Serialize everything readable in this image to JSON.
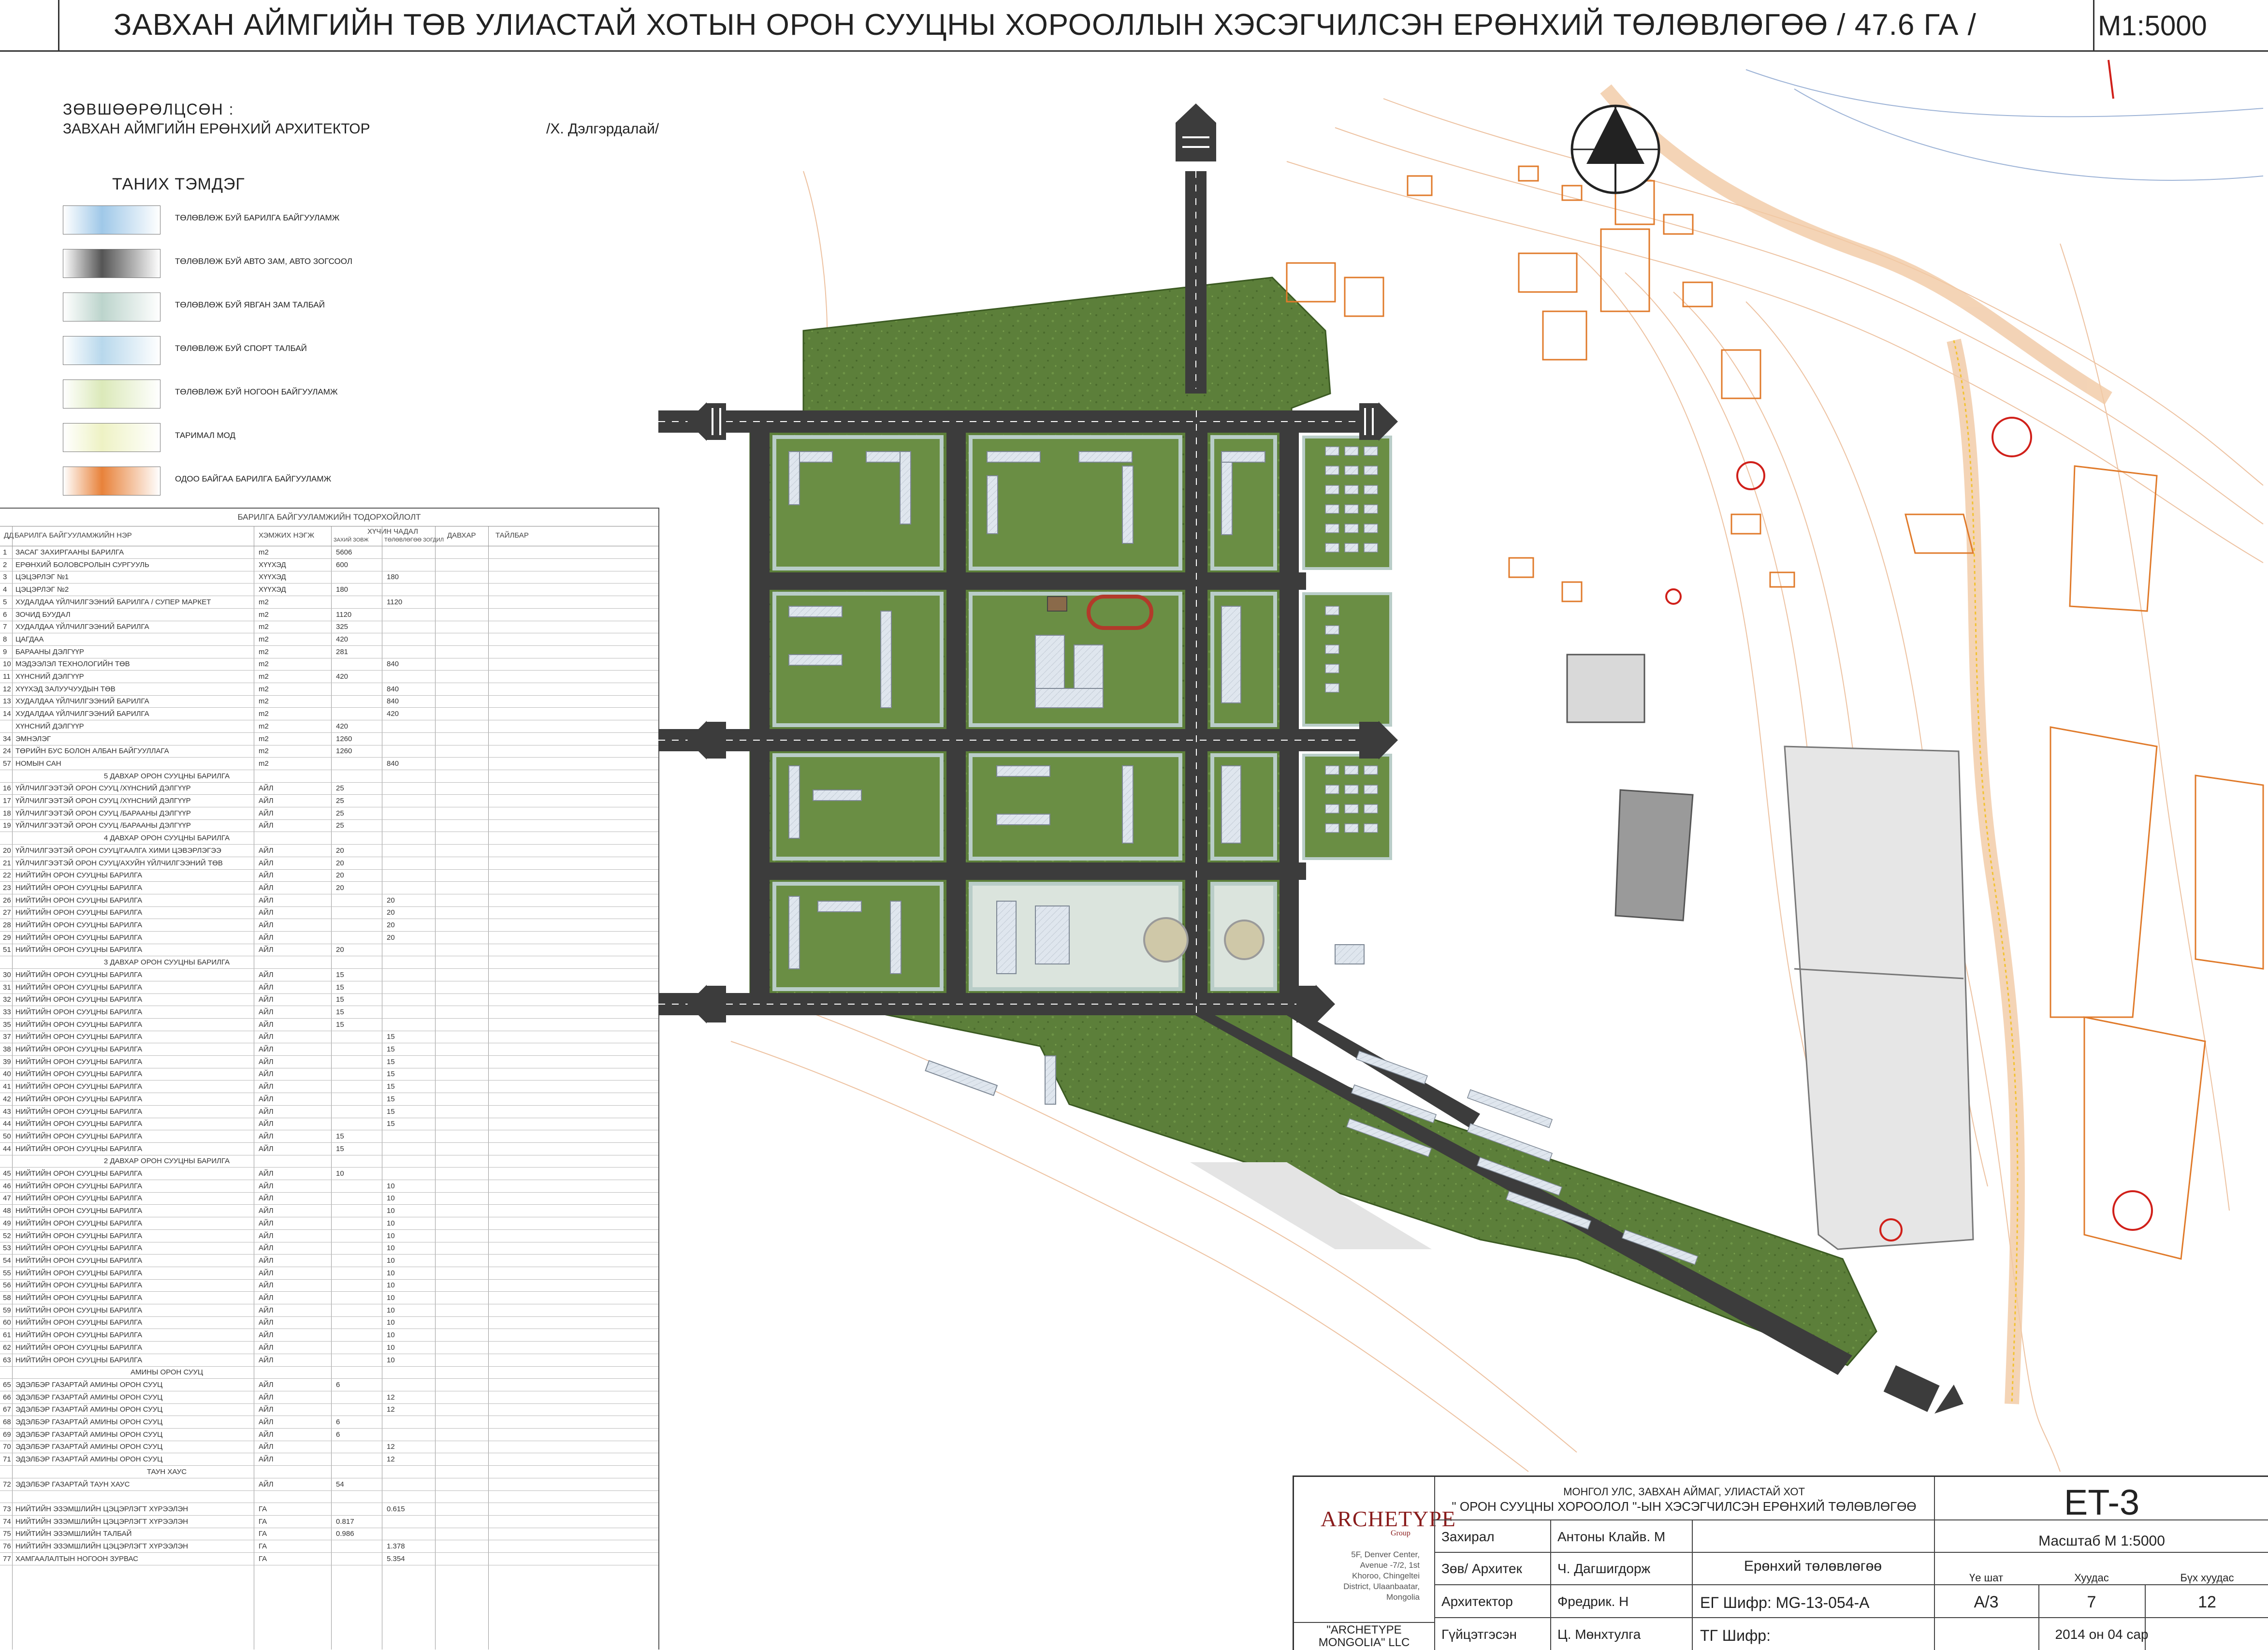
{
  "title_bar": {
    "title": "ЗАВХАН АЙМГИЙН ТӨВ УЛИАСТАЙ ХОТЫН ОРОН СУУЦНЫ ХОРООЛЛЫН ХЭСЭГЧИЛСЭН ЕРӨНХИЙ ТӨЛӨВЛӨГӨӨ / 47.6 ГА /",
    "scale": "М1:5000"
  },
  "approval": {
    "heading": "ЗӨВШӨӨРӨЛЦСӨН :",
    "position": "ЗАВХАН АЙМГИЙН ЕРӨНХИЙ АРХИТЕКТОР",
    "name": "/Х. Дэлгэрдалай/"
  },
  "legend": {
    "title": "ТАНИХ ТЭМДЭГ",
    "items": [
      {
        "label": "ТӨЛӨВЛӨЖ БУЙ БАРИЛГА БАЙГУУЛАМЖ",
        "icon": "building-swatch",
        "color": "#9fc8e8"
      },
      {
        "label": "ТӨЛӨВЛӨЖ БУЙ АВТО ЗАМ, АВТО ЗОГСООЛ",
        "icon": "road-swatch",
        "color": "#555555"
      },
      {
        "label": "ТӨЛӨВЛӨЖ БУЙ ЯВГАН ЗАМ ТАЛБАЙ",
        "icon": "sidewalk-swatch",
        "color": "#bcd4cc"
      },
      {
        "label": "ТӨЛӨВЛӨЖ БУЙ СПОРТ ТАЛБАЙ",
        "icon": "sport-swatch",
        "color": "#b8d8ec"
      },
      {
        "label": "ТӨЛӨВЛӨЖ БУЙ НОГООН БАЙГУУЛАМЖ",
        "icon": "green-swatch",
        "color": "#dbe9b9"
      },
      {
        "label": "ТАРИМАЛ МОД",
        "icon": "tree-swatch",
        "color": "#eef2c4"
      },
      {
        "label": "ОДОО БАЙГАА БАРИЛГА БАЙГУУЛАМЖ",
        "icon": "existing-building-swatch",
        "color": "#e8823a"
      }
    ]
  },
  "building_table": {
    "caption": "БАРИЛГА БАЙГУУЛАМЖИЙН ТОДОРХОЙЛОЛТ",
    "columns": [
      "ДД",
      "БАРИЛГА БАЙГУУЛАМЖИЙН НЭР",
      "ХЭМЖИХ НЭГЖ",
      "ХҮЧИН ЧАДАЛ",
      "ДАВХАР",
      "ТАЙЛБАР"
    ],
    "subcolumns": [
      "ЗАХИЙ ЗОВЖ",
      "ТӨЛӨВЛӨГӨӨ ЗОГДИЛ"
    ],
    "rows": [
      {
        "no": "1",
        "name": "ЗАСАГ ЗАХИРГААНЫ БАРИЛГА",
        "unit": "m2",
        "c1": "5606",
        "c2": ""
      },
      {
        "no": "2",
        "name": "ЕРӨНХИЙ БОЛОВСРОЛЫН СУРГУУЛЬ",
        "unit": "ХҮҮХЭД",
        "c1": "600",
        "c2": ""
      },
      {
        "no": "3",
        "name": "ЦЭЦЭРЛЭГ №1",
        "unit": "ХҮҮХЭД",
        "c1": "",
        "c2": "180"
      },
      {
        "no": "4",
        "name": "ЦЭЦЭРЛЭГ №2",
        "unit": "ХҮҮХЭД",
        "c1": "180",
        "c2": ""
      },
      {
        "no": "5",
        "name": "ХУДАЛДАА ҮЙЛЧИЛГЭЭНИЙ БАРИЛГА / СУПЕР МАРКЕТ",
        "unit": "m2",
        "c1": "",
        "c2": "1120"
      },
      {
        "no": "6",
        "name": "ЗОЧИД БУУДАЛ",
        "unit": "m2",
        "c1": "1120",
        "c2": ""
      },
      {
        "no": "7",
        "name": "ХУДАЛДАА ҮЙЛЧИЛГЭЭНИЙ БАРИЛГА",
        "unit": "m2",
        "c1": "325",
        "c2": ""
      },
      {
        "no": "8",
        "name": "ЦАГДАА",
        "unit": "m2",
        "c1": "420",
        "c2": ""
      },
      {
        "no": "9",
        "name": "БАРААНЫ ДЭЛГҮҮР",
        "unit": "m2",
        "c1": "281",
        "c2": ""
      },
      {
        "no": "10",
        "name": "МЭДЭЭЛЭЛ ТЕХНОЛОГИЙН ТӨВ",
        "unit": "m2",
        "c1": "",
        "c2": "840"
      },
      {
        "no": "11",
        "name": "ХҮНСНИЙ ДЭЛГҮҮР",
        "unit": "m2",
        "c1": "420",
        "c2": ""
      },
      {
        "no": "12",
        "name": "ХҮҮХЭД ЗАЛУУЧУУДЫН ТӨВ",
        "unit": "m2",
        "c1": "",
        "c2": "840"
      },
      {
        "no": "13",
        "name": "ХУДАЛДАА ҮЙЛЧИЛГЭЭНИЙ БАРИЛГА",
        "unit": "m2",
        "c1": "",
        "c2": "840"
      },
      {
        "no": "14",
        "name": "ХУДАЛДАА ҮЙЛЧИЛГЭЭНИЙ БАРИЛГА",
        "unit": "m2",
        "c1": "",
        "c2": "420"
      },
      {
        "no": "",
        "name": "ХҮНСНИЙ ДЭЛГҮҮР",
        "unit": "m2",
        "c1": "420",
        "c2": ""
      },
      {
        "no": "34",
        "name": "ЭМНЭЛЭГ",
        "unit": "m2",
        "c1": "1260",
        "c2": ""
      },
      {
        "no": "24",
        "name": "ТӨРИЙН БУС БОЛОН АЛБАН БАЙГУУЛЛАГА",
        "unit": "m2",
        "c1": "1260",
        "c2": ""
      },
      {
        "no": "57",
        "name": "НОМЫН САН",
        "unit": "m2",
        "c1": "",
        "c2": "840"
      },
      {
        "section": "5 ДАВХАР ОРОН СУУЦНЫ БАРИЛГА"
      },
      {
        "no": "16",
        "name": "ҮЙЛЧИЛГЭЭТЭЙ ОРОН СУУЦ /ХҮНСНИЙ ДЭЛГҮҮР",
        "unit": "АЙЛ",
        "c1": "25",
        "c2": ""
      },
      {
        "no": "17",
        "name": "ҮЙЛЧИЛГЭЭТЭЙ ОРОН СУУЦ /ХҮНСНИЙ ДЭЛГҮҮР",
        "unit": "АЙЛ",
        "c1": "25",
        "c2": ""
      },
      {
        "no": "18",
        "name": "ҮЙЛЧИЛГЭЭТЭЙ ОРОН СУУЦ /БАРААНЫ ДЭЛГҮҮР",
        "unit": "АЙЛ",
        "c1": "25",
        "c2": ""
      },
      {
        "no": "19",
        "name": "ҮЙЛЧИЛГЭЭТЭЙ ОРОН СУУЦ /БАРААНЫ ДЭЛГҮҮР",
        "unit": "АЙЛ",
        "c1": "25",
        "c2": ""
      },
      {
        "section": "4 ДАВХАР ОРОН СУУЦНЫ БАРИЛГА"
      },
      {
        "no": "20",
        "name": "ҮЙЛЧИЛГЭЭТЭЙ ОРОН СУУЦ/ГААЛГА ХИМИ ЦЭВЭРЛЭГЭЭ",
        "unit": "АЙЛ",
        "c1": "20",
        "c2": ""
      },
      {
        "no": "21",
        "name": "ҮЙЛЧИЛГЭЭТЭЙ ОРОН СУУЦ/АХУЙН ҮЙЛЧИЛГЭЭНИЙ ТӨВ",
        "unit": "АЙЛ",
        "c1": "20",
        "c2": ""
      },
      {
        "no": "22",
        "name": "НИЙТИЙН ОРОН СУУЦНЫ БАРИЛГА",
        "unit": "АЙЛ",
        "c1": "20",
        "c2": ""
      },
      {
        "no": "23",
        "name": "НИЙТИЙН ОРОН СУУЦНЫ БАРИЛГА",
        "unit": "АЙЛ",
        "c1": "20",
        "c2": ""
      },
      {
        "no": "26",
        "name": "НИЙТИЙН ОРОН СУУЦНЫ БАРИЛГА",
        "unit": "АЙЛ",
        "c1": "",
        "c2": "20"
      },
      {
        "no": "27",
        "name": "НИЙТИЙН ОРОН СУУЦНЫ БАРИЛГА",
        "unit": "АЙЛ",
        "c1": "",
        "c2": "20"
      },
      {
        "no": "28",
        "name": "НИЙТИЙН ОРОН СУУЦНЫ БАРИЛГА",
        "unit": "АЙЛ",
        "c1": "",
        "c2": "20"
      },
      {
        "no": "29",
        "name": "НИЙТИЙН ОРОН СУУЦНЫ БАРИЛГА",
        "unit": "АЙЛ",
        "c1": "",
        "c2": "20"
      },
      {
        "no": "51",
        "name": "НИЙТИЙН ОРОН СУУЦНЫ БАРИЛГА",
        "unit": "АЙЛ",
        "c1": "20",
        "c2": ""
      },
      {
        "section": "3 ДАВХАР ОРОН СУУЦНЫ БАРИЛГА"
      },
      {
        "no": "30",
        "name": "НИЙТИЙН ОРОН СУУЦНЫ БАРИЛГА",
        "unit": "АЙЛ",
        "c1": "15",
        "c2": ""
      },
      {
        "no": "31",
        "name": "НИЙТИЙН ОРОН СУУЦНЫ БАРИЛГА",
        "unit": "АЙЛ",
        "c1": "15",
        "c2": ""
      },
      {
        "no": "32",
        "name": "НИЙТИЙН ОРОН СУУЦНЫ БАРИЛГА",
        "unit": "АЙЛ",
        "c1": "15",
        "c2": ""
      },
      {
        "no": "33",
        "name": "НИЙТИЙН ОРОН СУУЦНЫ БАРИЛГА",
        "unit": "АЙЛ",
        "c1": "15",
        "c2": ""
      },
      {
        "no": "35",
        "name": "НИЙТИЙН ОРОН СУУЦНЫ БАРИЛГА",
        "unit": "АЙЛ",
        "c1": "15",
        "c2": ""
      },
      {
        "no": "37",
        "name": "НИЙТИЙН ОРОН СУУЦНЫ БАРИЛГА",
        "unit": "АЙЛ",
        "c1": "",
        "c2": "15"
      },
      {
        "no": "38",
        "name": "НИЙТИЙН ОРОН СУУЦНЫ БАРИЛГА",
        "unit": "АЙЛ",
        "c1": "",
        "c2": "15"
      },
      {
        "no": "39",
        "name": "НИЙТИЙН ОРОН СУУЦНЫ БАРИЛГА",
        "unit": "АЙЛ",
        "c1": "",
        "c2": "15"
      },
      {
        "no": "40",
        "name": "НИЙТИЙН ОРОН СУУЦНЫ БАРИЛГА",
        "unit": "АЙЛ",
        "c1": "",
        "c2": "15"
      },
      {
        "no": "41",
        "name": "НИЙТИЙН ОРОН СУУЦНЫ БАРИЛГА",
        "unit": "АЙЛ",
        "c1": "",
        "c2": "15"
      },
      {
        "no": "42",
        "name": "НИЙТИЙН ОРОН СУУЦНЫ БАРИЛГА",
        "unit": "АЙЛ",
        "c1": "",
        "c2": "15"
      },
      {
        "no": "43",
        "name": "НИЙТИЙН ОРОН СУУЦНЫ БАРИЛГА",
        "unit": "АЙЛ",
        "c1": "",
        "c2": "15"
      },
      {
        "no": "44",
        "name": "НИЙТИЙН ОРОН СУУЦНЫ БАРИЛГА",
        "unit": "АЙЛ",
        "c1": "",
        "c2": "15"
      },
      {
        "no": "50",
        "name": "НИЙТИЙН ОРОН СУУЦНЫ БАРИЛГА",
        "unit": "АЙЛ",
        "c1": "15",
        "c2": ""
      },
      {
        "no": "44",
        "name": "НИЙТИЙН ОРОН СУУЦНЫ БАРИЛГА",
        "unit": "АЙЛ",
        "c1": "15",
        "c2": ""
      },
      {
        "section": "2 ДАВХАР ОРОН СУУЦНЫ БАРИЛГА"
      },
      {
        "no": "45",
        "name": "НИЙТИЙН ОРОН СУУЦНЫ БАРИЛГА",
        "unit": "АЙЛ",
        "c1": "10",
        "c2": ""
      },
      {
        "no": "46",
        "name": "НИЙТИЙН ОРОН СУУЦНЫ БАРИЛГА",
        "unit": "АЙЛ",
        "c1": "",
        "c2": "10"
      },
      {
        "no": "47",
        "name": "НИЙТИЙН ОРОН СУУЦНЫ БАРИЛГА",
        "unit": "АЙЛ",
        "c1": "",
        "c2": "10"
      },
      {
        "no": "48",
        "name": "НИЙТИЙН ОРОН СУУЦНЫ БАРИЛГА",
        "unit": "АЙЛ",
        "c1": "",
        "c2": "10"
      },
      {
        "no": "49",
        "name": "НИЙТИЙН ОРОН СУУЦНЫ БАРИЛГА",
        "unit": "АЙЛ",
        "c1": "",
        "c2": "10"
      },
      {
        "no": "52",
        "name": "НИЙТИЙН ОРОН СУУЦНЫ БАРИЛГА",
        "unit": "АЙЛ",
        "c1": "",
        "c2": "10"
      },
      {
        "no": "53",
        "name": "НИЙТИЙН ОРОН СУУЦНЫ БАРИЛГА",
        "unit": "АЙЛ",
        "c1": "",
        "c2": "10"
      },
      {
        "no": "54",
        "name": "НИЙТИЙН ОРОН СУУЦНЫ БАРИЛГА",
        "unit": "АЙЛ",
        "c1": "",
        "c2": "10"
      },
      {
        "no": "55",
        "name": "НИЙТИЙН ОРОН СУУЦНЫ БАРИЛГА",
        "unit": "АЙЛ",
        "c1": "",
        "c2": "10"
      },
      {
        "no": "56",
        "name": "НИЙТИЙН ОРОН СУУЦНЫ БАРИЛГА",
        "unit": "АЙЛ",
        "c1": "",
        "c2": "10"
      },
      {
        "no": "58",
        "name": "НИЙТИЙН ОРОН СУУЦНЫ БАРИЛГА",
        "unit": "АЙЛ",
        "c1": "",
        "c2": "10"
      },
      {
        "no": "59",
        "name": "НИЙТИЙН ОРОН СУУЦНЫ БАРИЛГА",
        "unit": "АЙЛ",
        "c1": "",
        "c2": "10"
      },
      {
        "no": "60",
        "name": "НИЙТИЙН ОРОН СУУЦНЫ БАРИЛГА",
        "unit": "АЙЛ",
        "c1": "",
        "c2": "10"
      },
      {
        "no": "61",
        "name": "НИЙТИЙН ОРОН СУУЦНЫ БАРИЛГА",
        "unit": "АЙЛ",
        "c1": "",
        "c2": "10"
      },
      {
        "no": "62",
        "name": "НИЙТИЙН ОРОН СУУЦНЫ БАРИЛГА",
        "unit": "АЙЛ",
        "c1": "",
        "c2": "10"
      },
      {
        "no": "63",
        "name": "НИЙТИЙН ОРОН СУУЦНЫ БАРИЛГА",
        "unit": "АЙЛ",
        "c1": "",
        "c2": "10"
      },
      {
        "section": "АМИНЫ ОРОН СУУЦ"
      },
      {
        "no": "65",
        "name": "ЭДЭЛБЭР ГАЗАРТАЙ АМИНЫ ОРОН СУУЦ",
        "unit": "АЙЛ",
        "c1": "6",
        "c2": ""
      },
      {
        "no": "66",
        "name": "ЭДЭЛБЭР ГАЗАРТАЙ АМИНЫ ОРОН СУУЦ",
        "unit": "АЙЛ",
        "c1": "",
        "c2": "12"
      },
      {
        "no": "67",
        "name": "ЭДЭЛБЭР ГАЗАРТАЙ АМИНЫ ОРОН СУУЦ",
        "unit": "АЙЛ",
        "c1": "",
        "c2": "12"
      },
      {
        "no": "68",
        "name": "ЭДЭЛБЭР ГАЗАРТАЙ АМИНЫ ОРОН СУУЦ",
        "unit": "АЙЛ",
        "c1": "6",
        "c2": ""
      },
      {
        "no": "69",
        "name": "ЭДЭЛБЭР ГАЗАРТАЙ АМИНЫ ОРОН СУУЦ",
        "unit": "АЙЛ",
        "c1": "6",
        "c2": ""
      },
      {
        "no": "70",
        "name": "ЭДЭЛБЭР ГАЗАРТАЙ АМИНЫ ОРОН СУУЦ",
        "unit": "АЙЛ",
        "c1": "",
        "c2": "12"
      },
      {
        "no": "71",
        "name": "ЭДЭЛБЭР ГАЗАРТАЙ АМИНЫ ОРОН СУУЦ",
        "unit": "АЙЛ",
        "c1": "",
        "c2": "12"
      },
      {
        "section": "ТАУН ХАУС"
      },
      {
        "no": "72",
        "name": "ЭДЭЛБЭР ГАЗАРТАЙ ТАУН ХАУС",
        "unit": "АЙЛ",
        "c1": "54",
        "c2": ""
      },
      {
        "no": "",
        "name": "",
        "unit": "",
        "c1": "",
        "c2": ""
      },
      {
        "no": "73",
        "name": "НИЙТИЙН ЭЗЭМШЛИЙН ЦЭЦЭРЛЭГТ ХҮРЭЭЛЭН",
        "unit": "ГА",
        "c1": "",
        "c2": "0.615"
      },
      {
        "no": "74",
        "name": "НИЙТИЙН ЭЗЭМШЛИЙН ЦЭЦЭРЛЭГТ ХҮРЭЭЛЭН",
        "unit": "ГА",
        "c1": "0.817",
        "c2": ""
      },
      {
        "no": "75",
        "name": "НИЙТИЙН ЭЗЭМШЛИЙН ТАЛБАЙ",
        "unit": "ГА",
        "c1": "0.986",
        "c2": ""
      },
      {
        "no": "76",
        "name": "НИЙТИЙН ЭЗЭМШЛИЙН ЦЭЦЭРЛЭГТ ХҮРЭЭЛЭН",
        "unit": "ГА",
        "c1": "",
        "c2": "1.378"
      },
      {
        "no": "77",
        "name": "ХАМГААЛАЛТЫН НОГООН ЗУРВАС",
        "unit": "ГА",
        "c1": "",
        "c2": "5.354"
      }
    ]
  },
  "map": {
    "north_arrow": "north-arrow-icon",
    "colors": {
      "green": "#5c7f3a",
      "road": "#3c3c3c",
      "sidewalk": "#b9cdc8",
      "building": "#dfe6ee",
      "existing": "#e07a2a",
      "contour": "#e9b38a"
    }
  },
  "title_block": {
    "company_logo": "ARCHETYPE",
    "company_logo_sub": "Group",
    "address": [
      "5F, Denver Center,",
      "Avenue -7/2, 1st",
      "Khoroo, Chingeltei",
      "District, Ulaanbaatar,",
      "Mongolia"
    ],
    "company_name": "\"ARCHETYPE MONGOLIA\" LLC",
    "location": "МОНГОЛ УЛС, ЗАВХАН АЙМАГ, УЛИАСТАЙ ХОТ",
    "project": "\" ОРОН СУУЦНЫ ХОРООЛОЛ \"-ЫН ХЭСЭГЧИЛСЭН ЕРӨНХИЙ ТӨЛӨВЛӨГӨӨ",
    "roles": [
      {
        "role": "Захирал",
        "name": "Антоны Клайв. М"
      },
      {
        "role": "Зөв/ Архитек",
        "name": "Ч. Дагшигдорж"
      },
      {
        "role": "Архитектор",
        "name": "Фредрик. Н"
      },
      {
        "role": "Гүйцэтгэсэн",
        "name": "Ц. Мөнхтулга"
      }
    ],
    "sheet_title": "Ерөнхий төлөвлөгөө",
    "eg_code": "ЕГ Шифр: MG-13-054-A",
    "tg_code": "ТГ Шифр:",
    "sheet_id": "ET-3",
    "scale": "Масштаб М 1:5000",
    "labels": {
      "stage": "Үе шат",
      "page": "Хуудас",
      "total": "Бүх хуудас"
    },
    "values": {
      "stage": "A/3",
      "page": "7",
      "total": "12"
    },
    "date": "2014 он 04 сар"
  }
}
